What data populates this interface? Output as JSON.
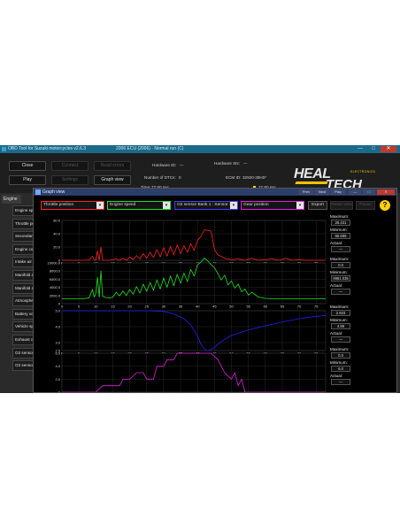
{
  "window": {
    "title": "OBD Tool for Suzuki motorcycles v2.6.3",
    "subtitle": "2006 ECU (2006) · Normal run (C)",
    "minimize": "—",
    "maximize": "□",
    "close": "✕"
  },
  "toolbar": {
    "close": "Close",
    "connect": "Connect",
    "read_errors": "Read errors",
    "play": "Play",
    "settings": "Settings",
    "graph_view": "Graph view"
  },
  "info": {
    "hardware_id_label": "Hardware ID:",
    "hardware_id_value": "—",
    "hardware_sn_label": "Hardware SN:",
    "hardware_sn_value": "—",
    "dtcs_label": "Number of DTCs:",
    "dtcs_value": "0",
    "ecm_id_label": "ECM ID:",
    "ecm_id_value": "32920-38H0*",
    "time_label": "Time:",
    "time_value": "77.80 sec",
    "time_end": "77.80 sec"
  },
  "logo": {
    "heal": "HEAL",
    "tech": "TECH",
    "electronics": "ELECTRONICS"
  },
  "sidebar": {
    "header": "Engine",
    "items": [
      {
        "label": "Engine spe"
      },
      {
        "label": "Throttle po"
      },
      {
        "label": "Secondary"
      },
      {
        "label": "Engine co"
      },
      {
        "label": "Intake air"
      },
      {
        "label": "Manifold ab"
      },
      {
        "label": "Manifold ab"
      },
      {
        "label": "Atmospher"
      },
      {
        "label": "Battery vol"
      },
      {
        "label": "Vehicle spe"
      },
      {
        "label": "Exhaust c"
      },
      {
        "label": "O2 sensor"
      },
      {
        "label": "O2 sensor"
      }
    ]
  },
  "graph_window": {
    "title": "Graph view",
    "buttons": [
      "Prev",
      "Next",
      "Play",
      "—",
      "□",
      "✕"
    ],
    "selectors": [
      "Throttle position",
      "Engine speed",
      "O2 sensor Bank 1 : Sensor 1",
      "Gear position"
    ],
    "export": "Export",
    "reset_view": "Reset view",
    "pause": "Pause",
    "help": "?"
  },
  "colors": {
    "throttle": "#ff2020",
    "rpm": "#20e020",
    "o2": "#2020ff",
    "gear": "#e020e0"
  },
  "chart_data": [
    {
      "type": "line",
      "series": [
        {
          "name": "Throttle position",
          "color": "#ff2020"
        }
      ],
      "x": [
        0,
        2,
        4,
        6,
        8,
        9,
        9.5,
        10,
        10.5,
        11,
        11.5,
        12,
        13,
        14,
        16,
        17,
        18,
        19,
        20,
        21,
        22,
        23,
        24,
        25,
        26,
        27,
        28,
        29,
        30,
        31,
        32,
        33,
        34,
        35,
        36,
        37,
        38,
        39,
        40,
        41,
        42,
        43,
        44,
        45,
        46,
        47,
        48,
        49,
        50,
        52,
        54,
        56,
        58,
        60,
        62,
        64,
        66,
        68,
        70,
        72,
        74,
        76,
        77.8
      ],
      "values": [
        0,
        0,
        0,
        0,
        0.5,
        6,
        1,
        0,
        14,
        0,
        20,
        0,
        0,
        0,
        2,
        0,
        3,
        0,
        5,
        1,
        7,
        2,
        10,
        3,
        12,
        4,
        16,
        5,
        19,
        6,
        21,
        8,
        23,
        10,
        22,
        12,
        25,
        15,
        30,
        36,
        46,
        45,
        44,
        16,
        8,
        6,
        3,
        2,
        1,
        2,
        0,
        3,
        0,
        1,
        2,
        0,
        3,
        0,
        1,
        0,
        0,
        0,
        0
      ],
      "xlim": [
        0,
        77.8
      ],
      "ylim": [
        0,
        60
      ],
      "yticks": [
        "0",
        "20.0",
        "40.0",
        "60.0"
      ],
      "xticks": [
        "0",
        "5",
        "10",
        "15",
        "20",
        "25",
        "30",
        "35",
        "40",
        "45",
        "50",
        "55",
        "60",
        "65",
        "70",
        "75"
      ],
      "stats": {
        "maximum_label": "Maximum:",
        "maximum": "28.431",
        "minimum_label": "Minimum:",
        "minimum": "65.686",
        "actual_label": "Actual:",
        "actual": "—"
      }
    },
    {
      "type": "line",
      "series": [
        {
          "name": "Engine speed",
          "color": "#20e020"
        }
      ],
      "x": [
        0,
        2,
        4,
        6,
        8,
        9,
        9.5,
        10,
        10.5,
        11,
        11.5,
        12,
        13,
        14,
        15,
        16,
        17,
        18,
        19,
        20,
        21,
        22,
        23,
        24,
        25,
        26,
        27,
        28,
        29,
        30,
        31,
        32,
        33,
        34,
        35,
        36,
        37,
        38,
        39,
        40,
        41,
        42,
        43,
        44,
        45,
        46,
        47,
        48,
        49,
        50,
        51,
        52,
        53,
        54,
        55,
        56,
        58,
        60,
        62,
        64,
        66,
        68,
        70,
        72,
        74,
        76,
        77.8
      ],
      "values": [
        1200,
        1200,
        1200,
        1200,
        1400,
        3500,
        1600,
        2500,
        6500,
        1600,
        8000,
        1800,
        1500,
        1400,
        1600,
        2800,
        1900,
        3100,
        2000,
        3500,
        2300,
        4200,
        2600,
        4800,
        3000,
        5200,
        3300,
        5800,
        3600,
        6300,
        4000,
        6800,
        4400,
        7200,
        5000,
        7500,
        5400,
        8400,
        6800,
        9500,
        10200,
        11200,
        10500,
        9600,
        8800,
        7400,
        5800,
        7000,
        4600,
        5600,
        3800,
        4800,
        2900,
        3600,
        2100,
        2800,
        1600,
        1300,
        1200,
        1200,
        1200,
        1200,
        1200,
        1200,
        1200,
        1200,
        1200
      ],
      "xlim": [
        0,
        77.8
      ],
      "ylim": [
        0,
        10000
      ],
      "yticks": [
        "0",
        "2000.0",
        "4000.0",
        "6000.0",
        "8000.0",
        "10000.0"
      ],
      "xticks": [
        "0",
        "5",
        "10",
        "15",
        "20",
        "25",
        "30",
        "35",
        "40",
        "45",
        "50",
        "55",
        "60",
        "65",
        "70",
        "75"
      ],
      "stats": {
        "maximum_label": "Maximum:",
        "maximum": "0.0",
        "minimum_label": "Minimum:",
        "minimum": "9961.035",
        "actual_label": "Actual:",
        "actual": "—"
      }
    },
    {
      "type": "line",
      "series": [
        {
          "name": "O2 sensor Bank 1 : Sensor 1",
          "color": "#2020ff"
        }
      ],
      "x": [
        0,
        5,
        10,
        15,
        20,
        25,
        30,
        33,
        36,
        38,
        40,
        41,
        42,
        43,
        44,
        45,
        46,
        48,
        50,
        55,
        60,
        65,
        70,
        75,
        77.8
      ],
      "values": [
        5.0,
        5.0,
        5.0,
        5.0,
        5.0,
        5.0,
        4.95,
        4.8,
        4.5,
        4.1,
        3.4,
        2.9,
        2.6,
        2.5,
        2.55,
        2.7,
        2.9,
        3.2,
        3.45,
        3.8,
        4.05,
        4.3,
        4.5,
        4.65,
        4.7
      ],
      "xlim": [
        0,
        77.8
      ],
      "ylim": [
        2.5,
        5.0
      ],
      "yticks": [
        "2.5",
        "3.0",
        "4.0",
        "5.0"
      ],
      "xticks": [
        "0",
        "5",
        "10",
        "15",
        "20",
        "25",
        "30",
        "35",
        "40",
        "45",
        "50",
        "55",
        "60",
        "65",
        "70",
        "75"
      ],
      "stats": {
        "maximum_label": "Maximum:",
        "maximum": "2.923",
        "minimum_label": "Minimum:",
        "minimum": "4.99",
        "actual_label": "Actual:",
        "actual": "—"
      }
    },
    {
      "type": "line",
      "series": [
        {
          "name": "Gear position",
          "color": "#e020e0"
        }
      ],
      "x": [
        0,
        10,
        12,
        17,
        18,
        20,
        22,
        24,
        25,
        27,
        28,
        30,
        31,
        33,
        34,
        36,
        37,
        44,
        46,
        47,
        48,
        50,
        51,
        52,
        53,
        54,
        56,
        77.8
      ],
      "values": [
        0,
        0,
        1,
        1,
        2,
        2,
        3,
        3,
        2,
        2,
        4,
        4,
        5,
        5,
        6,
        6,
        6,
        6,
        5,
        4,
        3,
        2,
        3,
        1,
        2,
        0,
        0,
        0
      ],
      "xlim": [
        0,
        77.8
      ],
      "ylim": [
        0,
        6
      ],
      "yticks": [
        "0",
        "2.0",
        "4.0",
        "6.0"
      ],
      "xticks": [
        "0",
        "5",
        "10",
        "15",
        "20",
        "25",
        "30",
        "35",
        "40",
        "45",
        "50",
        "55",
        "60",
        "65",
        "70",
        "75"
      ],
      "stats": {
        "maximum_label": "Maximum:",
        "maximum": "0.0",
        "minimum_label": "Minimum:",
        "minimum": "6.0",
        "actual_label": "Actual:",
        "actual": "—"
      }
    }
  ]
}
